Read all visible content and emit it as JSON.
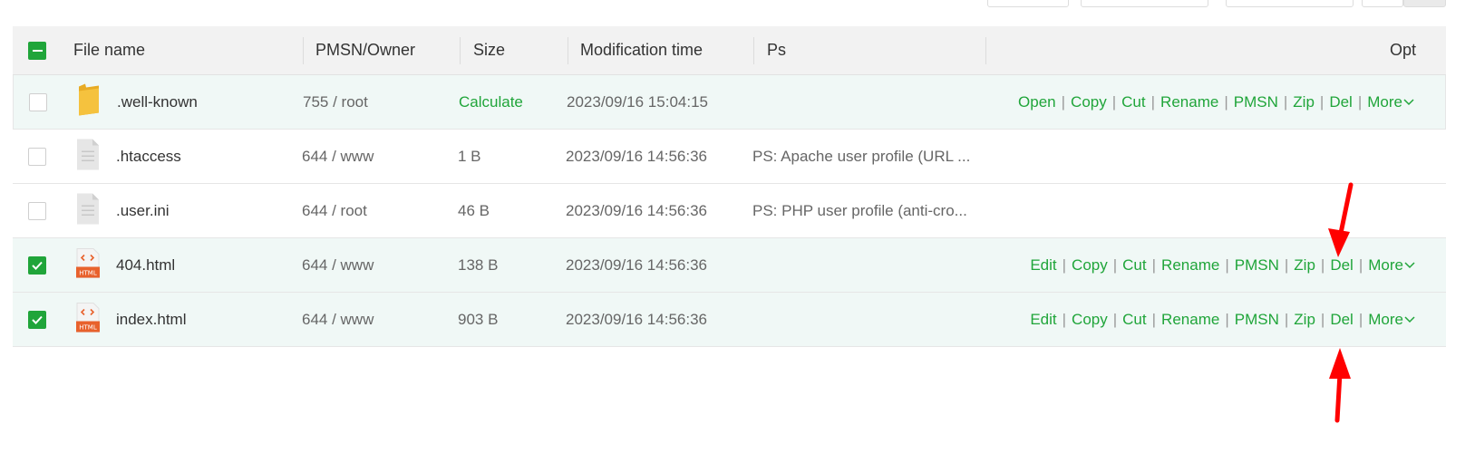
{
  "header": {
    "file_name": "File name",
    "pmsn_owner": "PMSN/Owner",
    "size": "Size",
    "modification_time": "Modification time",
    "ps": "Ps",
    "opt": "Opt"
  },
  "rows": [
    {
      "name": ".well-known",
      "perm": "755 / root",
      "size": "Calculate",
      "mtime": "2023/09/16 15:04:15",
      "ps": "",
      "checked": false,
      "icon": "folder-icon",
      "ops": [
        "Open",
        "Copy",
        "Cut",
        "Rename",
        "PMSN",
        "Zip",
        "Del",
        "More"
      ]
    },
    {
      "name": ".htaccess",
      "perm": "644 / www",
      "size": "1 B",
      "mtime": "2023/09/16 14:56:36",
      "ps": "PS: Apache user profile (URL ...",
      "checked": false,
      "icon": "file-icon",
      "ops": []
    },
    {
      "name": ".user.ini",
      "perm": "644 / root",
      "size": "46 B",
      "mtime": "2023/09/16 14:56:36",
      "ps": "PS: PHP user profile (anti-cro...",
      "checked": false,
      "icon": "file-icon",
      "ops": []
    },
    {
      "name": "404.html",
      "perm": "644 / www",
      "size": "138 B",
      "mtime": "2023/09/16 14:56:36",
      "ps": "",
      "checked": true,
      "icon": "html-file-icon",
      "ops": [
        "Edit",
        "Copy",
        "Cut",
        "Rename",
        "PMSN",
        "Zip",
        "Del",
        "More"
      ]
    },
    {
      "name": "index.html",
      "perm": "644 / www",
      "size": "903 B",
      "mtime": "2023/09/16 14:56:36",
      "ps": "",
      "checked": true,
      "icon": "html-file-icon",
      "ops": [
        "Edit",
        "Copy",
        "Cut",
        "Rename",
        "PMSN",
        "Zip",
        "Del",
        "More"
      ]
    }
  ],
  "html_badge": "HTML",
  "colors": {
    "accent": "#20a53a",
    "highlight_row": "#f0f8f6",
    "annotation_arrow": "#ff0000",
    "folder": "#f5c23e"
  }
}
